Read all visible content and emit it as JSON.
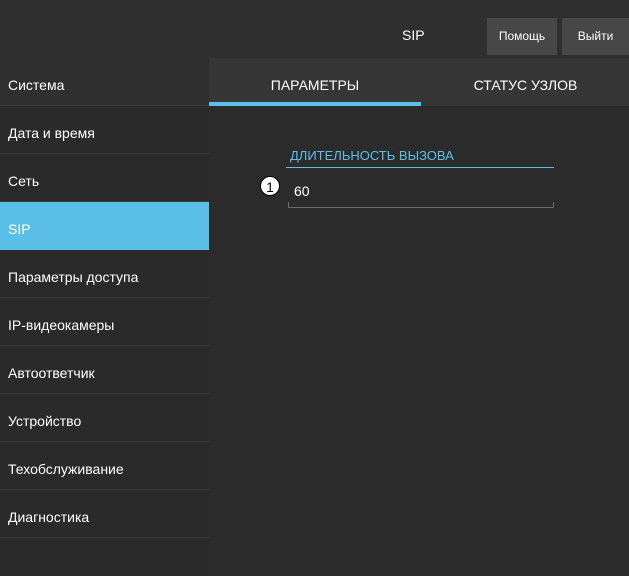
{
  "header": {
    "page_title": "SIP",
    "help_label": "Помощь",
    "exit_label": "Выйти"
  },
  "sidebar": {
    "items": [
      {
        "label": "Система"
      },
      {
        "label": "Дата и время"
      },
      {
        "label": "Сеть"
      },
      {
        "label": "SIP"
      },
      {
        "label": "Параметры доступа"
      },
      {
        "label": "IP-видеокамеры"
      },
      {
        "label": "Автоответчик"
      },
      {
        "label": "Устройство"
      },
      {
        "label": "Техобслуживание"
      },
      {
        "label": "Диагностика"
      }
    ],
    "active_item": "SIP"
  },
  "tabs": [
    {
      "label": "ПАРАМЕТРЫ",
      "active": true
    },
    {
      "label": "СТАТУС УЗЛОВ",
      "active": false
    }
  ],
  "main": {
    "call_duration": {
      "label": "ДЛИТЕЛЬНОСТЬ ВЫЗОВА",
      "value": "60",
      "callout": "1"
    }
  },
  "colors": {
    "accent": "#5ac0e8",
    "background": "#2b2b2b",
    "button": "#474747"
  }
}
